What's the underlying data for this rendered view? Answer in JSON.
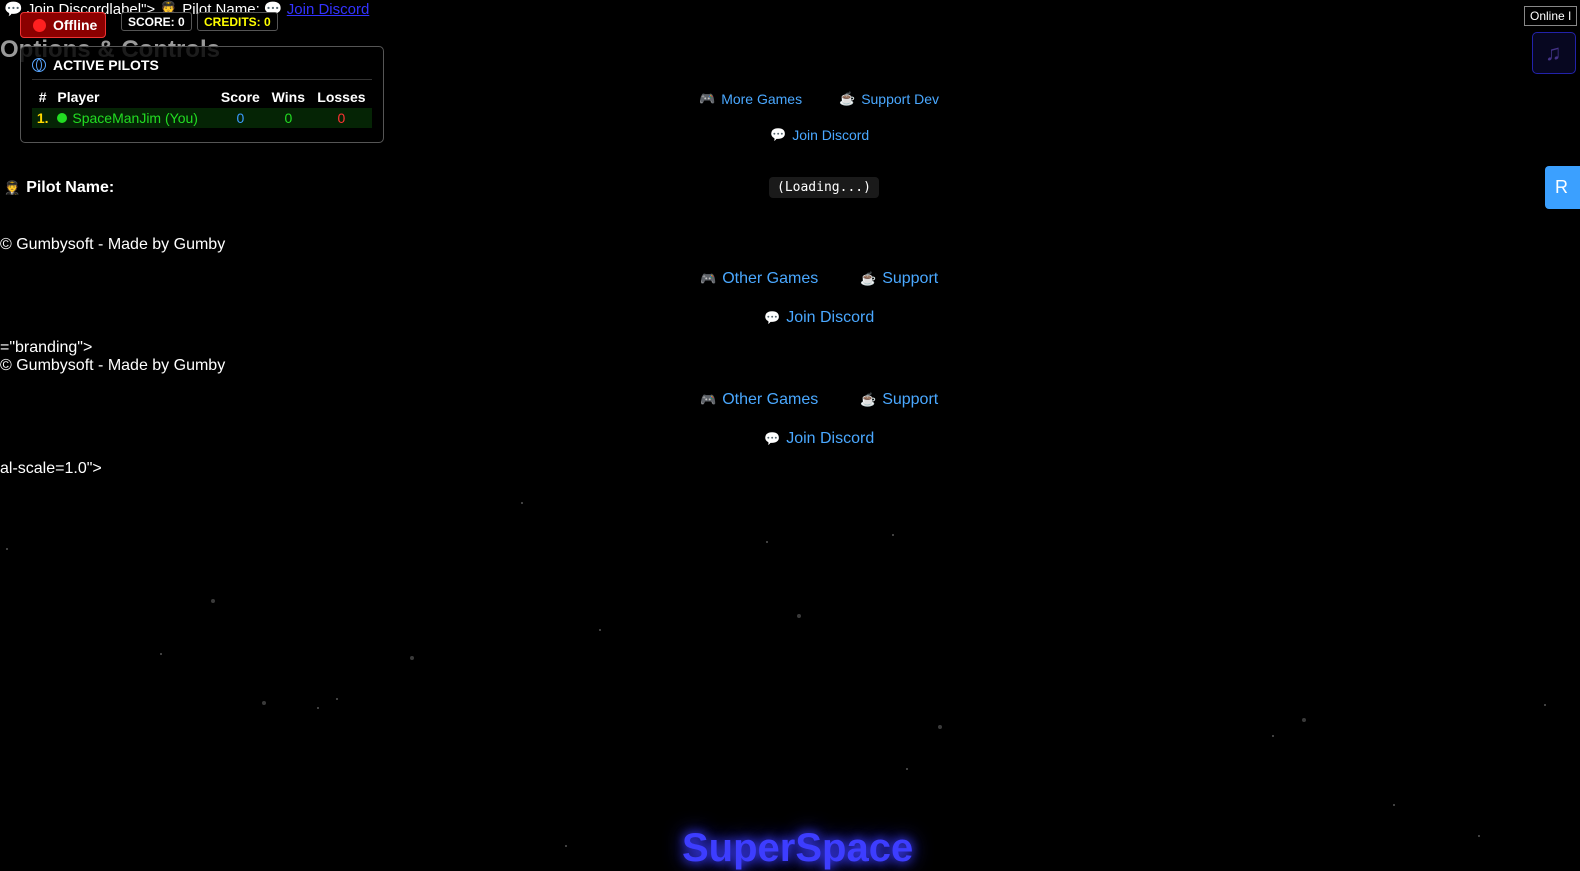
{
  "topline": {
    "broken_text": "Join Discordlabel\"> ",
    "pilot_label": "Pilot Name:",
    "discord_link": "Join Discord"
  },
  "status": {
    "label": "Offline",
    "color": "#ff2020"
  },
  "hud": {
    "score": "SCORE: 0",
    "credits": "CREDITS: 0"
  },
  "options_title": "Options & Controls",
  "leaderboard": {
    "title": "ACTIVE PILOTS",
    "columns": [
      "#",
      "Player",
      "Score",
      "Wins",
      "Losses"
    ],
    "rows": [
      {
        "rank": "1.",
        "player": "SpaceManJim (You)",
        "score": "0",
        "wins": "0",
        "losses": "0"
      }
    ]
  },
  "center_links": {
    "more_games": "More Games",
    "support_dev": "Support Dev",
    "join_discord": "Join Discord",
    "loading": "(Loading...)"
  },
  "pilot_name_label": "Pilot Name:",
  "footer": {
    "copyright": "© Gumbysoft - Made by Gumby",
    "other_games": "Other Games",
    "support": "Support",
    "join_discord": "Join Discord",
    "branding_fragment": "=\"branding\">",
    "scale_fragment": "al-scale=1.0\">"
  },
  "right": {
    "online_label": "Online I",
    "music_icon": "♫",
    "right_button": "R"
  },
  "game_title": "SuperSpace",
  "icons": {
    "discord": "speech-bubble-icon",
    "pilot": "pilot-icon",
    "games": "gamepad-icon",
    "support": "coffee-icon",
    "globe": "globe-icon"
  }
}
